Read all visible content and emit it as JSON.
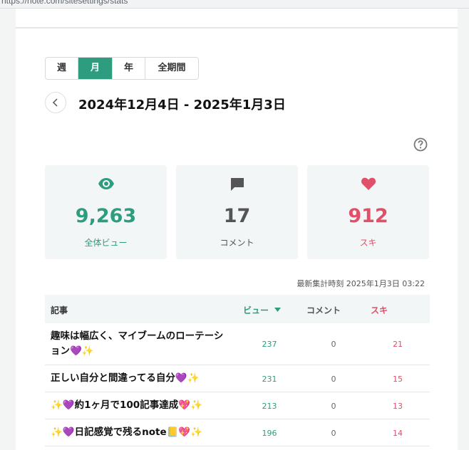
{
  "browser": {
    "url": "https://note.com/sitesettings/stats"
  },
  "tabs": [
    {
      "label": "週",
      "active": false
    },
    {
      "label": "月",
      "active": true
    },
    {
      "label": "年",
      "active": false
    },
    {
      "label": "全期間",
      "active": false
    }
  ],
  "date_range": "2024年12月4日 - 2025年1月3日",
  "stats": {
    "views": {
      "value": "9,263",
      "label": "全体ビュー",
      "icon": "eye-icon",
      "color": "#2e9c7e"
    },
    "comments": {
      "value": "17",
      "label": "コメント",
      "icon": "comment-icon",
      "color": "#555555"
    },
    "likes": {
      "value": "912",
      "label": "スキ",
      "icon": "heart-icon",
      "color": "#e0506a"
    }
  },
  "updated_at": "最新集計時刻 2025年1月3日 03:22",
  "table": {
    "headers": {
      "title": "記事",
      "views": "ビュー",
      "comments": "コメント",
      "likes": "スキ"
    },
    "rows": [
      {
        "title": "趣味は幅広く、マイブームのローテーション💜✨",
        "views": "237",
        "comments": "0",
        "likes": "21"
      },
      {
        "title": "正しい自分と間違ってる自分💜✨",
        "views": "231",
        "comments": "0",
        "likes": "15"
      },
      {
        "title": "✨💜約1ヶ月で100記事達成💖✨",
        "views": "213",
        "comments": "0",
        "likes": "13"
      },
      {
        "title": "✨💜日記感覚で残るnote📒💖✨",
        "views": "196",
        "comments": "0",
        "likes": "14"
      }
    ]
  }
}
